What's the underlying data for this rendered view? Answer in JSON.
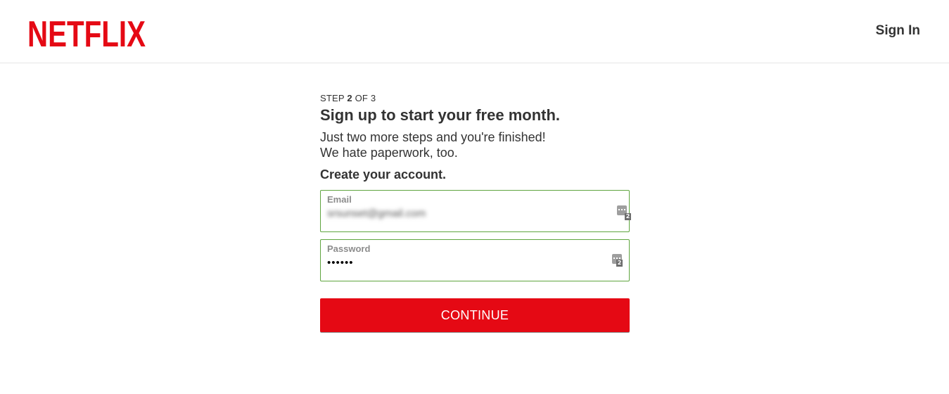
{
  "header": {
    "logo_text": "NETFLIX",
    "signin_label": "Sign In"
  },
  "signup": {
    "step_prefix": "STEP ",
    "step_current": "2",
    "step_suffix": " OF 3",
    "title": "Sign up to start your free month.",
    "subtext_line1": "Just two more steps and you're finished!",
    "subtext_line2": "We hate paperwork, too.",
    "create_heading": "Create your account.",
    "email": {
      "label": "Email",
      "value": "srsunset@gmail.com",
      "icon": "password-manager-icon",
      "badge": "2"
    },
    "password": {
      "label": "Password",
      "value": "••••••",
      "icon": "password-manager-icon",
      "badge": "2"
    },
    "continue_label": "CONTINUE"
  },
  "colors": {
    "brand_red": "#e50914",
    "field_border": "#5fa53f",
    "text": "#333333"
  }
}
